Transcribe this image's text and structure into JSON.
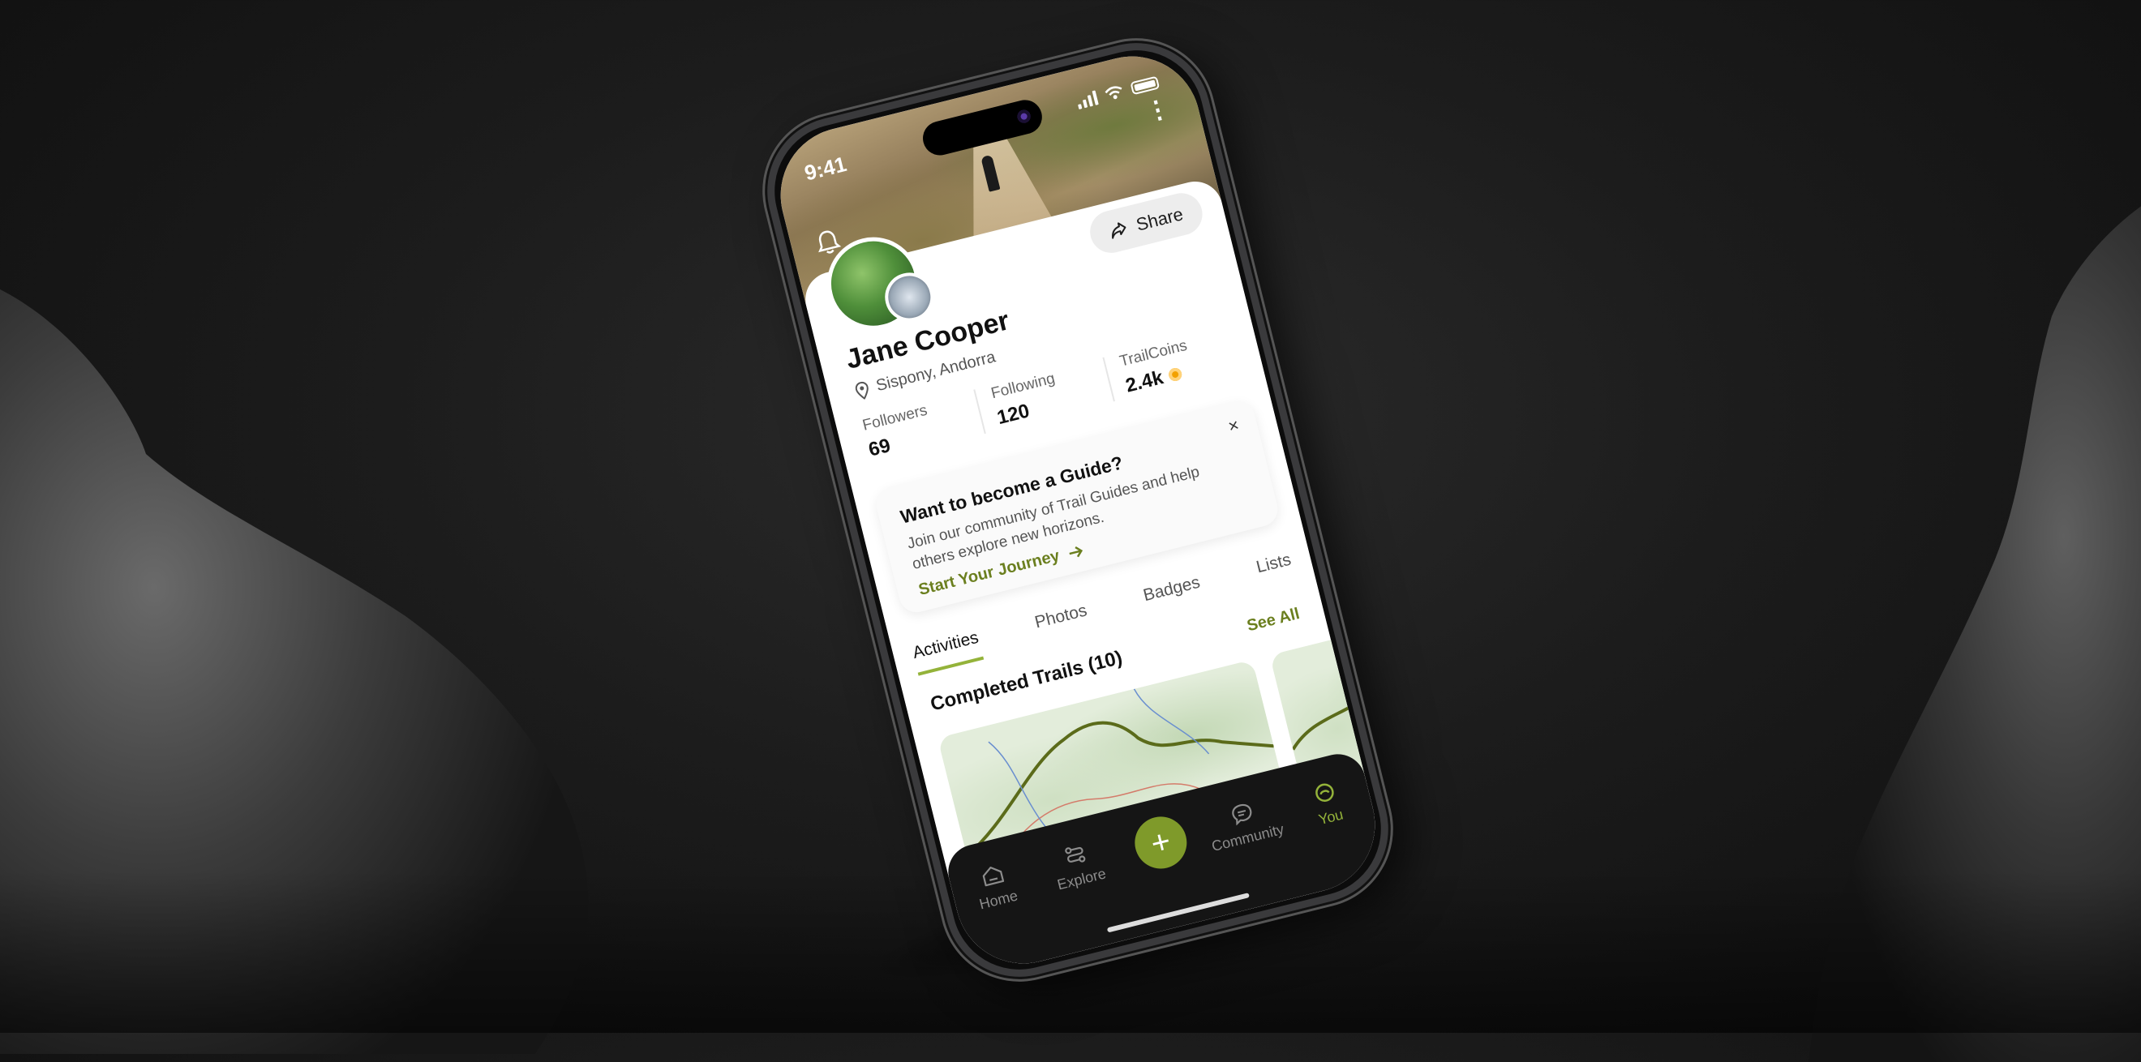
{
  "status_bar": {
    "time": "9:41"
  },
  "profile": {
    "name": "Jane Cooper",
    "location": "Sispony, Andorra",
    "share_label": "Share"
  },
  "stats": [
    {
      "label": "Followers",
      "value": "69"
    },
    {
      "label": "Following",
      "value": "120"
    },
    {
      "label": "TrailCoins",
      "value": "2.4k"
    }
  ],
  "guide_card": {
    "title": "Want to become a Guide?",
    "body": "Join our community of Trail Guides and help others explore new horizons.",
    "cta": "Start Your Journey",
    "close_icon": "×"
  },
  "tabs": [
    {
      "label": "Activities",
      "active": true
    },
    {
      "label": "Photos"
    },
    {
      "label": "Badges"
    },
    {
      "label": "Lists"
    }
  ],
  "section": {
    "title": "Completed Trails (10)",
    "see_all": "See All"
  },
  "bottom_nav": [
    {
      "label": "Home",
      "icon": "home-icon"
    },
    {
      "label": "Explore",
      "icon": "explore-icon"
    },
    {
      "label": "",
      "icon": "plus-icon"
    },
    {
      "label": "Community",
      "icon": "chat-icon"
    },
    {
      "label": "You",
      "icon": "profile-icon",
      "active": true
    }
  ],
  "colors": {
    "accent": "#94b33a",
    "accent_dark": "#6b7f1f",
    "nav_bg": "#151515",
    "coin": "#f2a100"
  }
}
